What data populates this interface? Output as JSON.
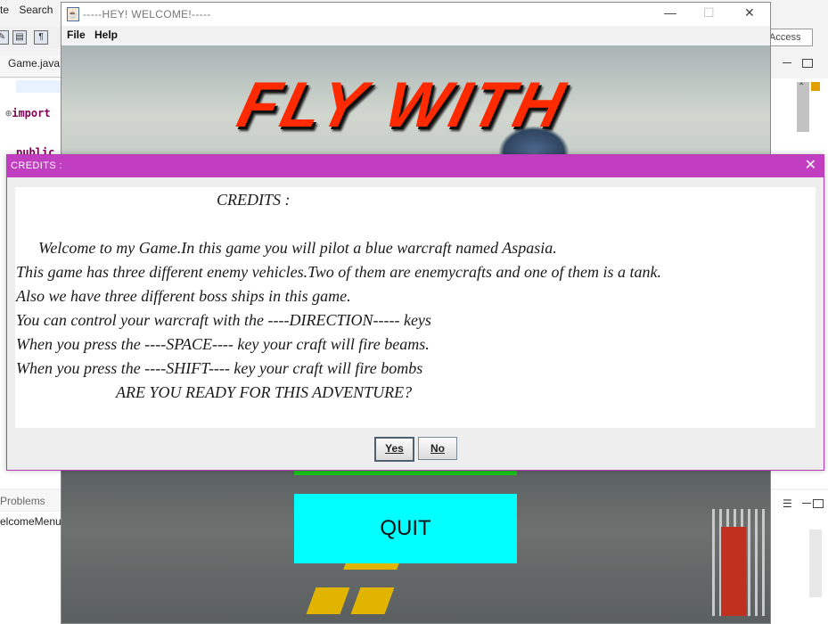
{
  "ide": {
    "menu": [
      "te",
      "Search"
    ],
    "access_label": "Access",
    "editor_tab": "Game.java",
    "code_import": "import",
    "code_public": "public",
    "problems_tab": "Problems",
    "problems_item": "elcomeMenu"
  },
  "game_window": {
    "title": "-----HEY!   WELCOME!-----",
    "menu": [
      "File",
      "Help"
    ],
    "banner_text": "FLY WITH",
    "quit_label": "QUIT",
    "controls": {
      "minimize": "—",
      "maximize": "☐",
      "close": "✕"
    }
  },
  "dialog": {
    "title": "CREDITS :",
    "close_glyph": "✕",
    "lines": [
      "CREDITS :",
      "Welcome to my Game.In this game you will pilot a blue warcraft named Aspasia.",
      "This game has three different enemy vehicles.Two of them are enemycrafts and one of them is a tank.",
      "Also we have three different boss ships in this game.",
      "You can control your warcraft with the ----DIRECTION----- keys",
      "When you press the ----SPACE---- key your craft will fire beams.",
      "When you press the ----SHIFT---- key your craft will fire bombs",
      "ARE YOU READY FOR THIS ADVENTURE?"
    ],
    "buttons": {
      "yes": "Yes",
      "no": "No"
    }
  },
  "colors": {
    "dialog_title_bar": "#c23ec0",
    "quit_button": "#00ffff",
    "progress_green": "#19c419",
    "banner_red": "#ff2a00"
  }
}
